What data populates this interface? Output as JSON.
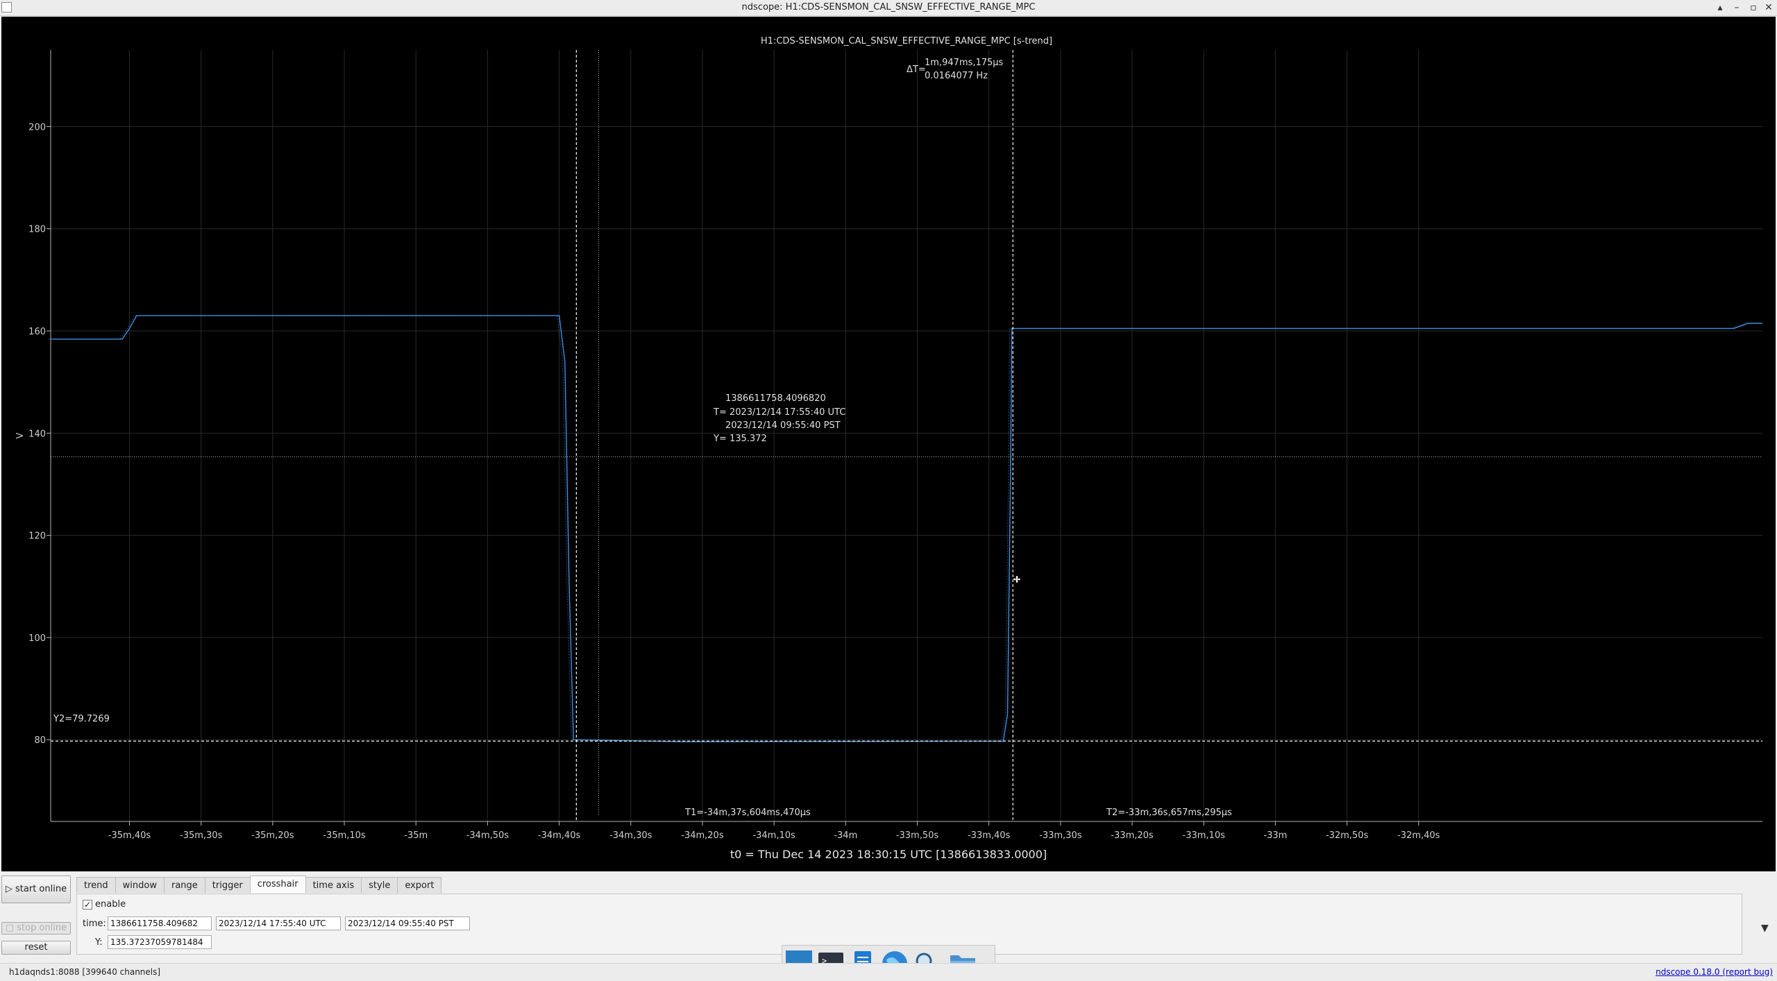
{
  "window": {
    "title": "ndscope: H1:CDS-SENSMON_CAL_SNSW_EFFECTIVE_RANGE_MPC",
    "minimize_glyph": "▴",
    "iconify_glyph": "–",
    "maximize_glyph": "▫",
    "close_glyph": "✕"
  },
  "plot": {
    "channel_title": "H1:CDS-SENSMON_CAL_SNSW_EFFECTIVE_RANGE_MPC [s-trend]",
    "ylabel": "V",
    "delta_label": "ΔT=",
    "delta_time": "1m,947ms,175μs",
    "delta_freq": "0.0164077 Hz",
    "crosshair_gps": "1386611758.4096820",
    "crosshair_utc": "T= 2023/12/14 17:55:40 UTC",
    "crosshair_pst": "2023/12/14 09:55:40 PST",
    "crosshair_y": "Y= 135.372",
    "y2_label": "Y2=79.7269",
    "t1_label": "T1=-34m,37s,604ms,470μs",
    "t2_label": "T2=-33m,36s,657ms,295μs",
    "t0_label": "t0 = Thu Dec 14 2023 18:30:15 UTC [1386613833.0000]",
    "colors": {
      "trace": "#3d8fe0",
      "cursor": "#e6e6e6",
      "axis": "#b8b8b8",
      "grid": "#2a2a2a"
    },
    "chart_data": {
      "type": "line",
      "ylim": [
        64,
        215
      ],
      "xlim": [
        -2151,
        -1912
      ],
      "yticks": [
        80,
        100,
        120,
        140,
        160,
        180,
        200
      ],
      "xticks": [
        {
          "t": -2140,
          "label": "-35m,40s"
        },
        {
          "t": -2130,
          "label": "-35m,30s"
        },
        {
          "t": -2120,
          "label": "-35m,20s"
        },
        {
          "t": -2110,
          "label": "-35m,10s"
        },
        {
          "t": -2100,
          "label": "-35m"
        },
        {
          "t": -2090,
          "label": "-34m,50s"
        },
        {
          "t": -2080,
          "label": "-34m,40s"
        },
        {
          "t": -2070,
          "label": "-34m,30s"
        },
        {
          "t": -2060,
          "label": "-34m,20s"
        },
        {
          "t": -2050,
          "label": "-34m,10s"
        },
        {
          "t": -2040,
          "label": "-34m"
        },
        {
          "t": -2030,
          "label": "-33m,50s"
        },
        {
          "t": -2020,
          "label": "-33m,40s"
        },
        {
          "t": -2010,
          "label": "-33m,30s"
        },
        {
          "t": -2000,
          "label": "-33m,20s"
        },
        {
          "t": -1990,
          "label": "-33m,10s"
        },
        {
          "t": -1980,
          "label": "-33m"
        },
        {
          "t": -1970,
          "label": "-32m,50s"
        },
        {
          "t": -1960,
          "label": "-32m,40s"
        }
      ],
      "series": [
        {
          "x": [
            -2151,
            -2141,
            -2140,
            -2139,
            -2080,
            -2079.2,
            -2078.6,
            -2078,
            -2063,
            -2018,
            -2017.4,
            -2017,
            -2016.8,
            -1916,
            -1914,
            -1912
          ],
          "y": [
            158.4,
            158.4,
            160.5,
            163,
            163,
            154,
            110,
            80,
            79.6,
            79.7,
            85,
            130,
            160.5,
            160.5,
            161.5,
            161.5
          ]
        }
      ],
      "cursors": {
        "t1": -2077.6,
        "t2": -2016.65,
        "y1": 135.372,
        "y2": 79.7269,
        "crosshair_t": -2074.5
      }
    }
  },
  "tabs": [
    "trend",
    "window",
    "range",
    "trigger",
    "crosshair",
    "time axis",
    "style",
    "export"
  ],
  "active_tab": "crosshair",
  "controls": {
    "start_online": "▷ start online",
    "stop_online": "▢ stop online",
    "reset": "reset",
    "enable_label": "enable",
    "enable_check": "✓",
    "time_label": "time:",
    "time_gps": "1386611758.409682",
    "time_utc": "2023/12/14 17:55:40 UTC",
    "time_pst": "2023/12/14 09:55:40 PST",
    "y_label": "Y:",
    "y_value": "135.37237059781484",
    "collapse_glyph": "▼"
  },
  "status": {
    "server": "h1daqnds1:8088  [399640 channels]",
    "version": "ndscope 0.18.0",
    "report": "(report bug)"
  }
}
